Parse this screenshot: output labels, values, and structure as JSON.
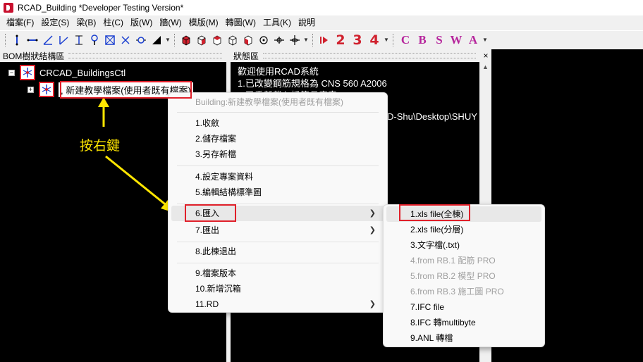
{
  "window": {
    "title": "RCAD_Building *Developer Testing Version*",
    "app_icon": "rcad-logo-icon"
  },
  "menubar": [
    "檔案(F)",
    "設定(S)",
    "梁(B)",
    "柱(C)",
    "版(W)",
    "牆(W)",
    "模版(M)",
    "轉圖(W)",
    "工具(K)",
    "說明"
  ],
  "toolbar": {
    "numbers": [
      "2",
      "3",
      "4"
    ],
    "letters": [
      "C",
      "B",
      "S",
      "W",
      "A"
    ]
  },
  "panels": {
    "bom_title": "BOM樹狀結構區",
    "status_title": "狀態區",
    "close_glyph": "×"
  },
  "tree": {
    "root_label": "CRCAD_BuildingsCtl",
    "child_label": ", 新建教學檔案(使用者既有檔案)",
    "expander_glyph": "−",
    "child_expander_glyph": "+"
  },
  "status": {
    "lines": [
      "歡迎使用RCAD系統",
      "1.已改變鋼筋規格為 CNS 560 A2006",
      "2.已重新載入樑筋長度表",
      "D-Shu\\Desktop\\SHUY"
    ]
  },
  "annotation": {
    "text": "按右鍵",
    "color": "#ffe600"
  },
  "context_menu": {
    "header": "Building:新建教學檔案(使用者既有檔案)",
    "items": [
      "1.收斂",
      "2.儲存檔案",
      "3.另存新檔",
      "4.設定專案資料",
      "5.編輯結構標準圖",
      "6.匯入",
      "7.匯出",
      "8.此棟退出",
      "9.檔案版本",
      "10.新增沉箱",
      "11.RD"
    ]
  },
  "submenu": {
    "items": [
      "1.xls file(全棟)",
      "2.xls file(分層)",
      "3.文字檔(.txt)",
      "4.from RB.1 配筋 PRO",
      "5.from RB.2 模型 PRO",
      "6.from RB.3 施工圖 PRO",
      "7.IFC file",
      "8.IFC 轉multibyte",
      "9.ANL 轉檔"
    ]
  },
  "colors": {
    "highlight_red": "#e0202a",
    "toolbar_number_red": "#d0212e",
    "toolbar_letter_magenta": "#b6259c",
    "panel_background": "#000000"
  }
}
